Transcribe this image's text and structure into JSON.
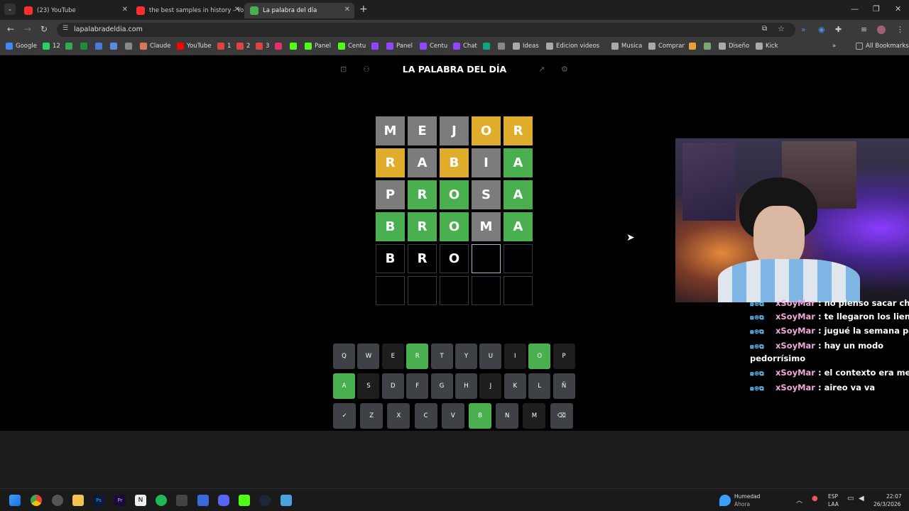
{
  "tabs": [
    {
      "title": "(23) YouTube",
      "color": "#ff2d2d"
    },
    {
      "title": "the best samples in history - Yo",
      "color": "#ff2d2d"
    },
    {
      "title": "La palabra del día",
      "color": "#4ab04f"
    }
  ],
  "url": "lapalabradeldia.com",
  "bookmarks": [
    {
      "label": "Google",
      "color": "#4285f4"
    },
    {
      "label": "12",
      "color": "#25d366"
    },
    {
      "label": "",
      "color": "#34a853"
    },
    {
      "label": "",
      "color": "#1e8e3e"
    },
    {
      "label": "",
      "color": "#4a7bd8"
    },
    {
      "label": "",
      "color": "#5a8ad8"
    },
    {
      "label": "",
      "color": "#888"
    },
    {
      "label": "Claude",
      "color": "#d97757"
    },
    {
      "label": "YouTube",
      "color": "#ff0000"
    },
    {
      "label": "1",
      "color": "#d44"
    },
    {
      "label": "2",
      "color": "#d44"
    },
    {
      "label": "3",
      "color": "#d44"
    },
    {
      "label": "",
      "color": "#e1306c"
    },
    {
      "label": "",
      "color": "#53fc18"
    },
    {
      "label": "Panel",
      "color": "#53fc18"
    },
    {
      "label": "Centu",
      "color": "#53fc18"
    },
    {
      "label": "",
      "color": "#9146ff"
    },
    {
      "label": "Panel",
      "color": "#9146ff"
    },
    {
      "label": "Centu",
      "color": "#9146ff"
    },
    {
      "label": "Chat",
      "color": "#9146ff"
    },
    {
      "label": "",
      "color": "#10a37f"
    },
    {
      "label": "",
      "color": "#888"
    },
    {
      "label": "Ideas",
      "color": "#aaa"
    },
    {
      "label": "Edicion videos",
      "color": "#aaa"
    },
    {
      "label": "Musica",
      "color": "#aaa"
    },
    {
      "label": "Comprar",
      "color": "#aaa"
    },
    {
      "label": "",
      "color": "#e6a23c"
    },
    {
      "label": "",
      "color": "#7a7"
    },
    {
      "label": "Diseño",
      "color": "#aaa"
    },
    {
      "label": "Kick",
      "color": "#aaa"
    }
  ],
  "all_bookmarks": "All Bookmarks",
  "game": {
    "title": "LA PALABRA DEL DÍA",
    "board": [
      [
        {
          "l": "M",
          "s": "gray"
        },
        {
          "l": "E",
          "s": "gray"
        },
        {
          "l": "J",
          "s": "gray"
        },
        {
          "l": "O",
          "s": "yellow"
        },
        {
          "l": "R",
          "s": "yellow"
        }
      ],
      [
        {
          "l": "R",
          "s": "yellow"
        },
        {
          "l": "A",
          "s": "gray"
        },
        {
          "l": "B",
          "s": "yellow"
        },
        {
          "l": "I",
          "s": "gray"
        },
        {
          "l": "A",
          "s": "green"
        }
      ],
      [
        {
          "l": "P",
          "s": "gray"
        },
        {
          "l": "R",
          "s": "green"
        },
        {
          "l": "O",
          "s": "green"
        },
        {
          "l": "S",
          "s": "gray"
        },
        {
          "l": "A",
          "s": "green"
        }
      ],
      [
        {
          "l": "B",
          "s": "green"
        },
        {
          "l": "R",
          "s": "green"
        },
        {
          "l": "O",
          "s": "green"
        },
        {
          "l": "M",
          "s": "gray"
        },
        {
          "l": "A",
          "s": "green"
        }
      ],
      [
        {
          "l": "B",
          "s": "typed"
        },
        {
          "l": "R",
          "s": "typed"
        },
        {
          "l": "O",
          "s": "typed"
        },
        {
          "l": "",
          "s": "active"
        },
        {
          "l": "",
          "s": "empty"
        }
      ],
      [
        {
          "l": "",
          "s": "empty"
        },
        {
          "l": "",
          "s": "empty"
        },
        {
          "l": "",
          "s": "empty"
        },
        {
          "l": "",
          "s": "empty"
        },
        {
          "l": "",
          "s": "empty"
        }
      ]
    ],
    "keyboard": [
      [
        {
          "k": "Q",
          "s": "normal"
        },
        {
          "k": "W",
          "s": "normal"
        },
        {
          "k": "E",
          "s": "dark"
        },
        {
          "k": "R",
          "s": "green"
        },
        {
          "k": "T",
          "s": "normal"
        },
        {
          "k": "Y",
          "s": "normal"
        },
        {
          "k": "U",
          "s": "normal"
        },
        {
          "k": "I",
          "s": "dark"
        },
        {
          "k": "O",
          "s": "green"
        },
        {
          "k": "P",
          "s": "dark"
        }
      ],
      [
        {
          "k": "A",
          "s": "green"
        },
        {
          "k": "S",
          "s": "dark"
        },
        {
          "k": "D",
          "s": "normal"
        },
        {
          "k": "F",
          "s": "normal"
        },
        {
          "k": "G",
          "s": "normal"
        },
        {
          "k": "H",
          "s": "normal"
        },
        {
          "k": "J",
          "s": "dark"
        },
        {
          "k": "K",
          "s": "normal"
        },
        {
          "k": "L",
          "s": "normal"
        },
        {
          "k": "Ñ",
          "s": "normal"
        }
      ],
      [
        {
          "k": "✓",
          "s": "normal"
        },
        {
          "k": "Z",
          "s": "normal"
        },
        {
          "k": "X",
          "s": "normal"
        },
        {
          "k": "C",
          "s": "normal"
        },
        {
          "k": "V",
          "s": "normal"
        },
        {
          "k": "B",
          "s": "green"
        },
        {
          "k": "N",
          "s": "normal"
        },
        {
          "k": "M",
          "s": "dark"
        },
        {
          "k": "⌫",
          "s": "normal"
        }
      ]
    ]
  },
  "chat": [
    {
      "user": "xSoyMar",
      "text": "no pienso sacar chip"
    },
    {
      "user": "xSoyMar",
      "text": "te llegaron los lienzos?"
    },
    {
      "user": "xSoyMar",
      "text": "jugué la semana pasada"
    },
    {
      "user": "xSoyMar",
      "text": "hay un modo",
      "cont": "pedorrísimo"
    },
    {
      "user": "xSoyMar",
      "text": "el contexto era mejor"
    },
    {
      "user": "xSoyMar",
      "text": "aireo va va"
    }
  ],
  "taskbar": {
    "weather_title": "Humedad",
    "weather_sub": "Ahora",
    "lang_top": "ESP",
    "lang_bottom": "LAA",
    "time": "22:07",
    "date": "26/3/2026"
  }
}
